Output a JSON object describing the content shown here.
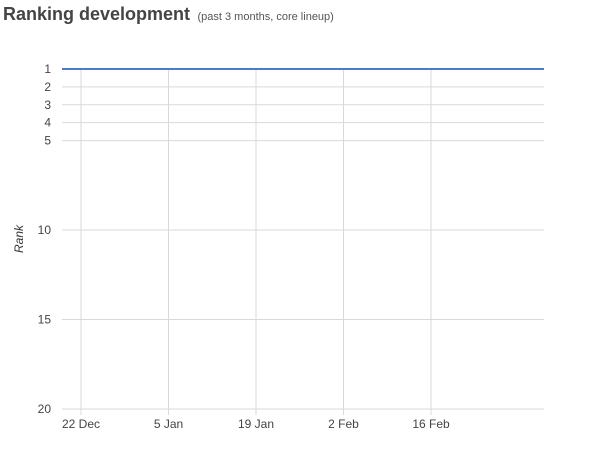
{
  "header": {
    "title": "Ranking development",
    "subtitle": "(past 3 months, core lineup)"
  },
  "chart_data": {
    "type": "line",
    "title": "Ranking development",
    "subtitle": "(past 3 months, core lineup)",
    "xlabel": "",
    "ylabel": "Rank",
    "y_reversed": true,
    "ylim": [
      1,
      20
    ],
    "yticks": [
      1,
      2,
      3,
      4,
      5,
      10,
      15,
      20
    ],
    "x_ticks": [
      "22 Dec",
      "5 Jan",
      "19 Jan",
      "2 Feb",
      "16 Feb"
    ],
    "grid": true,
    "legend": "none",
    "series": [
      {
        "color": "#4a7bd0",
        "x": [
          "22 Dec",
          "5 Jan",
          "19 Jan",
          "2 Feb",
          "16 Feb"
        ],
        "values": [
          1,
          1,
          1,
          1,
          1
        ]
      }
    ]
  }
}
